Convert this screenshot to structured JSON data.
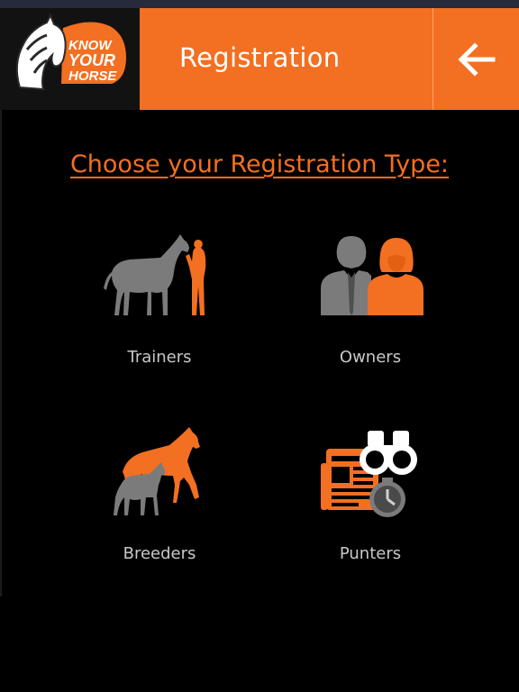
{
  "header": {
    "title": "Registration",
    "logo": {
      "line1": "KNOW",
      "line2": "YOUR",
      "line3": "HORSE"
    },
    "back_icon": "arrow-left-icon"
  },
  "main": {
    "heading": "Choose your Registration Type:",
    "types": [
      {
        "label": "Trainers",
        "icon": "trainer-horse-icon"
      },
      {
        "label": "Owners",
        "icon": "owners-people-icon"
      },
      {
        "label": "Breeders",
        "icon": "mare-foal-icon"
      },
      {
        "label": "Punters",
        "icon": "newspaper-binoculars-stopwatch-icon"
      }
    ]
  },
  "colors": {
    "accent": "#f36f21",
    "grey": "#7b7b7b",
    "background": "#000000",
    "label": "#c8c8c8"
  }
}
